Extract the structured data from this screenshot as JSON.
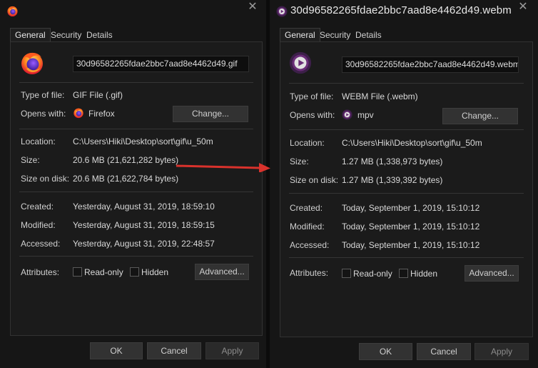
{
  "arrow_color": "#d9322c",
  "left": {
    "title_icon": "firefox-icon",
    "close_glyph": "✕",
    "tabs": [
      "General",
      "Security",
      "Details"
    ],
    "file_icon": "firefox-icon",
    "filename": "30d96582265fdae2bbc7aad8e4462d49.gif",
    "type_label": "Type of file:",
    "type_value": "GIF File (.gif)",
    "opens_label": "Opens with:",
    "opens_app": "Firefox",
    "opens_app_icon": "firefox-icon",
    "change_label": "Change...",
    "location_label": "Location:",
    "location_value": "C:\\Users\\Hiki\\Desktop\\sort\\gif\\u_50m",
    "size_label": "Size:",
    "size_value": "20.6 MB (21,621,282 bytes)",
    "sizedisk_label": "Size on disk:",
    "sizedisk_value": "20.6 MB (21,622,784 bytes)",
    "created_label": "Created:",
    "created_value": "Yesterday, August 31, 2019, 18:59:10",
    "modified_label": "Modified:",
    "modified_value": "Yesterday, August 31, 2019, 18:59:15",
    "accessed_label": "Accessed:",
    "accessed_value": "Yesterday, August 31, 2019, 22:48:57",
    "attributes_label": "Attributes:",
    "readonly_label": "Read-only",
    "hidden_label": "Hidden",
    "advanced_label": "Advanced...",
    "ok_label": "OK",
    "cancel_label": "Cancel",
    "apply_label": "Apply"
  },
  "right": {
    "title_icon": "mpv-icon",
    "title": "30d96582265fdae2bbc7aad8e4462d49.webm",
    "close_glyph": "✕",
    "tabs": [
      "General",
      "Security",
      "Details"
    ],
    "file_icon": "mpv-icon",
    "filename": "30d96582265fdae2bbc7aad8e4462d49.webm",
    "type_label": "Type of file:",
    "type_value": "WEBM File (.webm)",
    "opens_label": "Opens with:",
    "opens_app": "mpv",
    "opens_app_icon": "mpv-icon",
    "change_label": "Change...",
    "location_label": "Location:",
    "location_value": "C:\\Users\\Hiki\\Desktop\\sort\\gif\\u_50m",
    "size_label": "Size:",
    "size_value": "1.27 MB (1,338,973 bytes)",
    "sizedisk_label": "Size on disk:",
    "sizedisk_value": "1.27 MB (1,339,392 bytes)",
    "created_label": "Created:",
    "created_value": "Today, September 1, 2019, 15:10:12",
    "modified_label": "Modified:",
    "modified_value": "Today, September 1, 2019, 15:10:12",
    "accessed_label": "Accessed:",
    "accessed_value": "Today, September 1, 2019, 15:10:12",
    "attributes_label": "Attributes:",
    "readonly_label": "Read-only",
    "hidden_label": "Hidden",
    "advanced_label": "Advanced...",
    "ok_label": "OK",
    "cancel_label": "Cancel",
    "apply_label": "Apply"
  }
}
